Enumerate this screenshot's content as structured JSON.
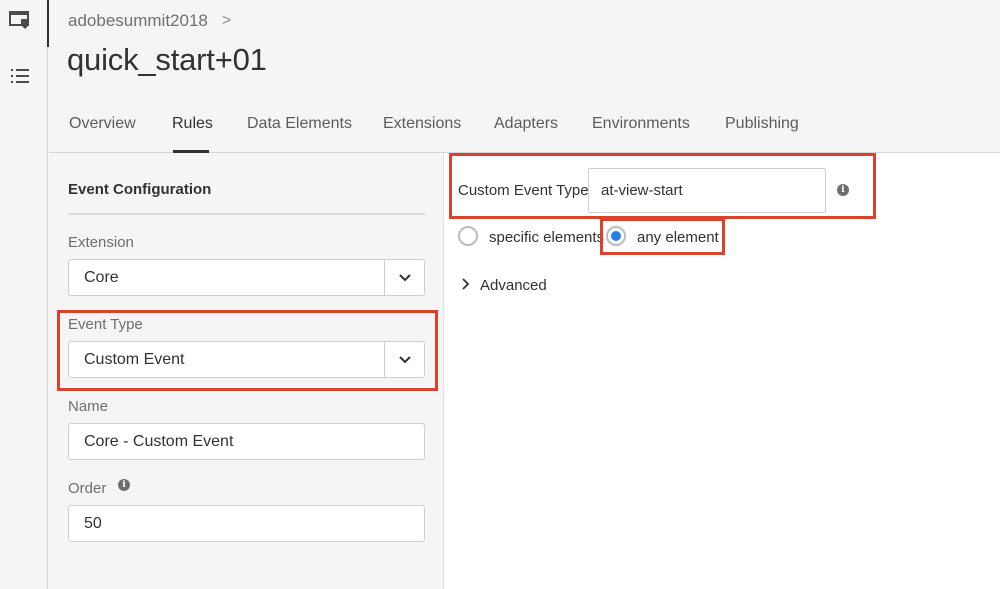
{
  "rail": {
    "icons": [
      "property-icon",
      "list-icon"
    ]
  },
  "header": {
    "breadcrumb": "adobesummit2018",
    "breadcrumb_separator": ">",
    "title": "quick_start+01",
    "tabs": [
      "Overview",
      "Rules",
      "Data Elements",
      "Extensions",
      "Adapters",
      "Environments",
      "Publishing"
    ],
    "active_tab": "Rules"
  },
  "event_config": {
    "heading": "Event Configuration",
    "extension_label": "Extension",
    "extension_value": "Core",
    "event_type_label": "Event Type",
    "event_type_value": "Custom Event",
    "name_label": "Name",
    "name_value": "Core - Custom Event",
    "order_label": "Order",
    "order_value": "50"
  },
  "custom_event": {
    "label": "Custom Event Type",
    "value": "at-view-start",
    "radio_specific": "specific elements",
    "radio_any": "any element",
    "selected": "any element",
    "advanced": "Advanced"
  },
  "colors": {
    "highlight": "#d9432c",
    "radio_selected": "#2680eb"
  }
}
